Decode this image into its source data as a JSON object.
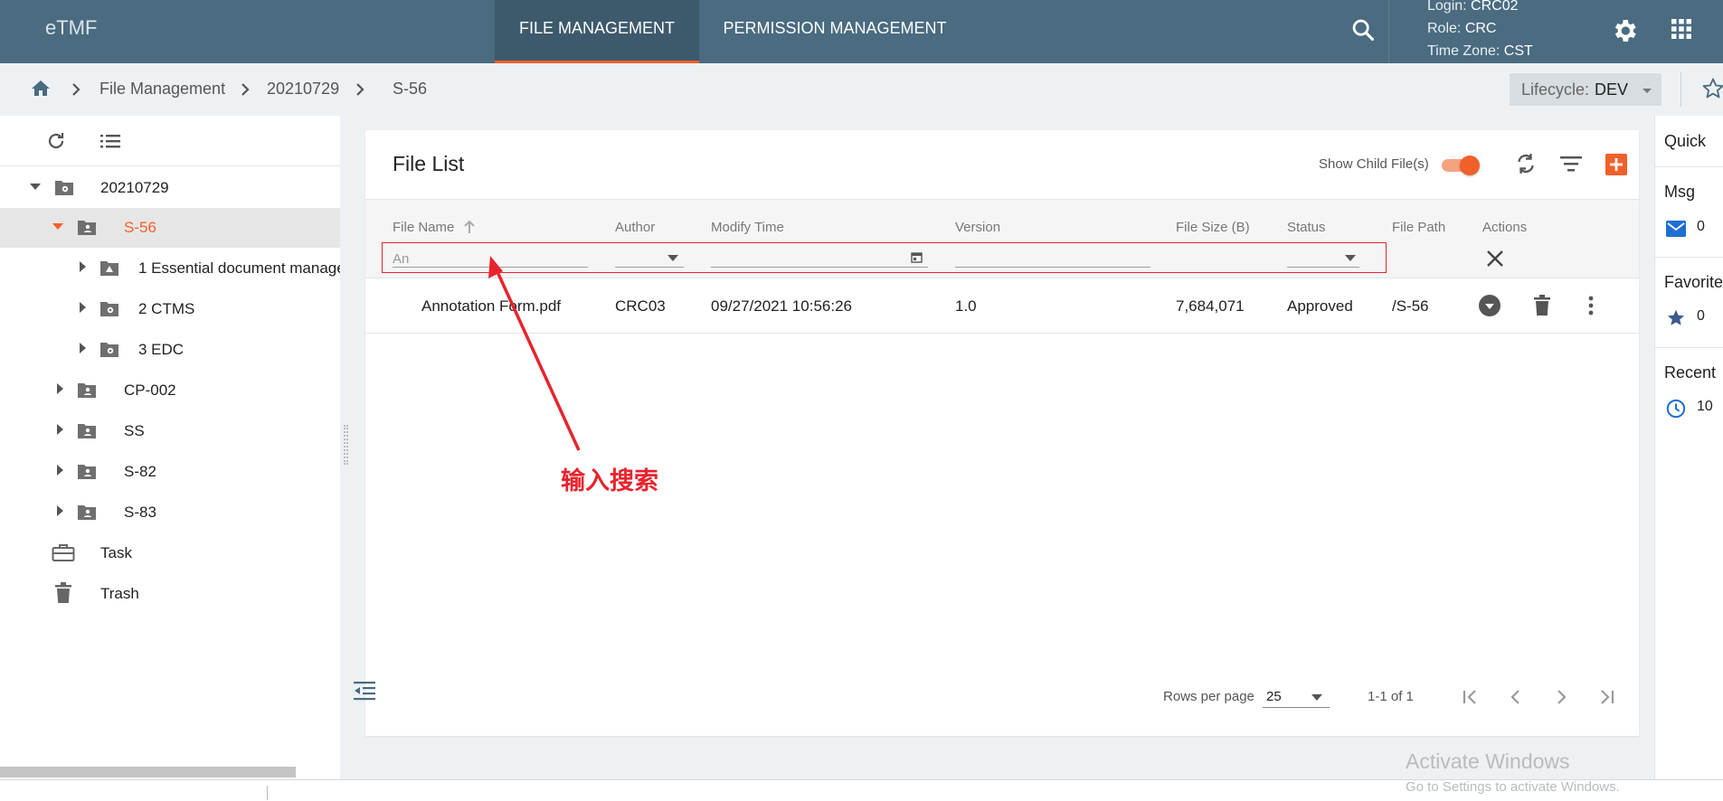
{
  "app": {
    "logo": "eTMF"
  },
  "nav": {
    "tabs": [
      {
        "label": "FILE MANAGEMENT",
        "active": true
      },
      {
        "label": "PERMISSION MANAGEMENT",
        "active": false
      }
    ]
  },
  "user": {
    "login_label": "Login:",
    "login": "CRC02",
    "role_label": "Role:",
    "role": "CRC",
    "tz_label": "Time Zone:",
    "tz": "CST"
  },
  "breadcrumb": [
    "File Management",
    "20210729",
    "S-56"
  ],
  "lifecycle": {
    "label": "Lifecycle:",
    "value": "DEV"
  },
  "tree": {
    "items": [
      {
        "label": "20210729",
        "icon": "folder-gear-icon",
        "expanded": true
      },
      {
        "label": "S-56",
        "icon": "folder-person-icon",
        "expanded": true,
        "selected": true
      },
      {
        "label": "1  Essential document manage",
        "icon": "folder-triangle-icon"
      },
      {
        "label": "2  CTMS",
        "icon": "folder-gear-icon"
      },
      {
        "label": "3  EDC",
        "icon": "folder-gear-icon"
      },
      {
        "label": "CP-002",
        "icon": "folder-person-icon"
      },
      {
        "label": "SS",
        "icon": "folder-person-icon"
      },
      {
        "label": "S-82",
        "icon": "folder-person-icon"
      },
      {
        "label": "S-83",
        "icon": "folder-person-icon"
      }
    ],
    "task": "Task",
    "trash": "Trash"
  },
  "file_list": {
    "title": "File List",
    "show_child_label": "Show Child File(s)",
    "show_child_on": true,
    "columns": [
      "File Name",
      "Author",
      "Modify Time",
      "Version",
      "File Size (B)",
      "Status",
      "File Path",
      "Actions"
    ],
    "filter": {
      "file_name": "An"
    },
    "rows": [
      {
        "file_name": "Annotation Form.pdf",
        "author": "CRC03",
        "modify_time": "09/27/2021 10:56:26",
        "version": "1.0",
        "file_size": "7,684,071",
        "status": "Approved",
        "file_path": "/S-56"
      }
    ],
    "rows_per_page_label": "Rows per page",
    "rows_per_page": "25",
    "range": "1-1 of 1"
  },
  "quick": {
    "title": "Quick",
    "msg": {
      "label": "Msg",
      "count": "0"
    },
    "favorites": {
      "label": "Favorites",
      "count": "0"
    },
    "recent": {
      "label": "Recent",
      "count": "10"
    }
  },
  "annotation": {
    "text": "输入搜索"
  },
  "watermark": {
    "line1": "Activate Windows",
    "line2": "Go to Settings to activate Windows."
  },
  "colors": {
    "header": "#4a6b80",
    "accent": "#f2602a",
    "annotation": "#e8232d"
  }
}
